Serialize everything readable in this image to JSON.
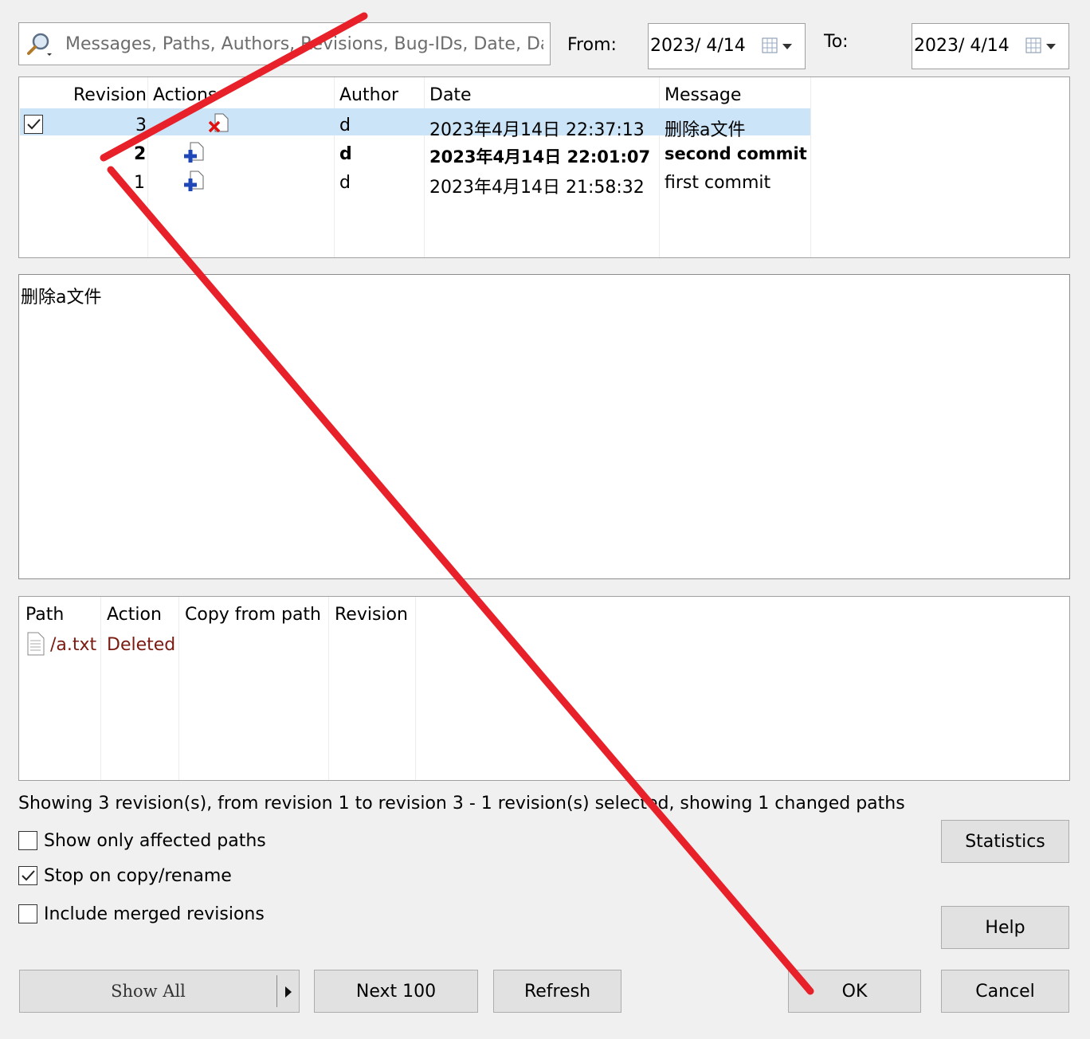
{
  "search": {
    "placeholder": "Messages, Paths, Authors, Revisions, Bug-IDs, Date, Da"
  },
  "filter": {
    "from_label": "From:",
    "from_value": "2023/  4/14",
    "to_label": "To:",
    "to_value": "2023/  4/14"
  },
  "revisions": {
    "headers": [
      "Revision",
      "Actions",
      "Author",
      "Date",
      "Message"
    ],
    "rows": [
      {
        "revision": "3",
        "action": "deleted",
        "author": "d",
        "date": "2023年4月14日 22:37:13",
        "message": "删除a文件",
        "selected": true,
        "bold": false
      },
      {
        "revision": "2",
        "action": "added",
        "author": "d",
        "date": "2023年4月14日 22:01:07",
        "message": "second commit",
        "selected": false,
        "bold": true
      },
      {
        "revision": "1",
        "action": "added",
        "author": "d",
        "date": "2023年4月14日 21:58:32",
        "message": "first commit",
        "selected": false,
        "bold": false
      }
    ]
  },
  "message_text": "删除a文件",
  "paths": {
    "headers": [
      "Path",
      "Action",
      "Copy from path",
      "Revision"
    ],
    "rows": [
      {
        "path": "/a.txt",
        "action": "Deleted"
      }
    ]
  },
  "status": "Showing 3 revision(s), from revision 1 to revision 3 - 1 revision(s) selected, showing 1 changed paths",
  "options": {
    "affected": {
      "label": "Show only affected paths",
      "checked": false
    },
    "stop": {
      "label": "Stop on copy/rename",
      "checked": true
    },
    "merged": {
      "label": "Include merged revisions",
      "checked": false
    }
  },
  "buttons": {
    "statistics": "Statistics",
    "help": "Help",
    "show_all": "Show All",
    "next": "Next 100",
    "refresh": "Refresh",
    "ok": "OK",
    "cancel": "Cancel"
  },
  "colors": {
    "selection": "#cce4f7",
    "deleted_text": "#7a1a10",
    "annotation": "#e8202a",
    "add_icon": "#1f47b8",
    "delete_icon": "#e01010"
  },
  "icons": [
    "magnifier-icon",
    "dropdown-arrow-icon",
    "calendar-icon",
    "delete-file-icon",
    "add-file-icon",
    "file-icon",
    "split-arrow-icon"
  ]
}
